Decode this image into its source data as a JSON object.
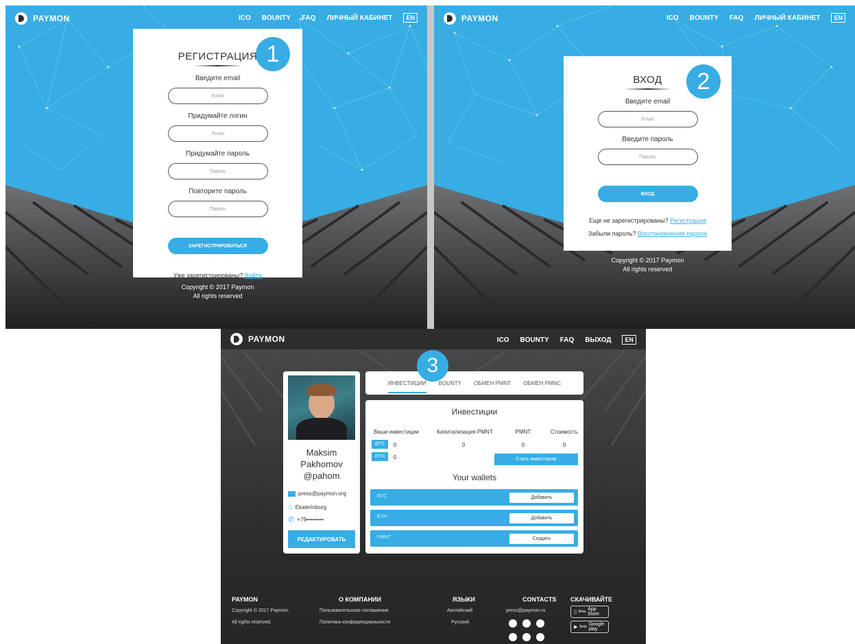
{
  "brand": "PAYMON",
  "colors": {
    "accent": "#37ade4",
    "dark": "#2d2d2d",
    "white": "#ffffff"
  },
  "register": {
    "nav": [
      "ICO",
      "BOUNTY",
      "FAQ",
      "ЛИЧНЫЙ КАБИНЕТ"
    ],
    "lang": "EN",
    "title": "РЕГИСТРАЦИЯ",
    "step": "1",
    "fields": [
      {
        "label": "Введите email",
        "placeholder": "Email"
      },
      {
        "label": "Придумайте логин",
        "placeholder": "Логин"
      },
      {
        "label": "Придумайте пароль",
        "placeholder": "Пароль"
      },
      {
        "label": "Повторите пароль",
        "placeholder": "Пароль"
      }
    ],
    "submit": "ЗАРЕГИСТРИРОВАТЬСЯ",
    "already": "Уже зарегистрированы?",
    "login_link": "Войти",
    "copyright": "Copyright © 2017 Paymon",
    "rights": "All rights reserved"
  },
  "login": {
    "nav": [
      "ICO",
      "BOUNTY",
      "FAQ",
      "ЛИЧНЫЙ КАБИНЕТ"
    ],
    "lang": "EN",
    "title": "ВХОД",
    "step": "2",
    "fields": [
      {
        "label": "Введите email",
        "placeholder": "Email"
      },
      {
        "label": "Введите пароль",
        "placeholder": "Пароль"
      }
    ],
    "submit": "ВХОД",
    "not_registered": "Еще не зарегистрированы?",
    "register_link": "Регистрация",
    "forgot": "Забыли пароль?",
    "restore_link": "Восстановление пароля",
    "copyright": "Copyright © 2017 Paymon",
    "rights": "All rights reserved"
  },
  "cabinet": {
    "nav": [
      "ICO",
      "BOUNTY",
      "FAQ",
      "ВЫХОД"
    ],
    "lang": "EN",
    "step": "3",
    "profile": {
      "first": "Maksim",
      "last": "Pakhomov",
      "handle": "@pahom",
      "email": "press@paymon.org",
      "city": "Ekaterinburg",
      "phone": "+79•••••••••",
      "edit": "РЕДАКТИРОВАТЬ"
    },
    "tabs": [
      "ИНВЕСТИЦИИ",
      "BOUNTY",
      "ОБМЕН PMNT",
      "ОБМЕН PMNC"
    ],
    "investments": {
      "title": "Инвестиции",
      "headers": [
        "Ваши инвестиции",
        "Капитализация PMNT",
        "PMNT",
        "Стоимость"
      ],
      "btc_tag": "BTC",
      "btc_val": "0",
      "eth_tag": "ETH",
      "eth_val": "0",
      "cap": "0",
      "pmnt": "0",
      "cost": "0",
      "invest_btn": "Стать инвестором"
    },
    "wallets": {
      "title": "Your wallets",
      "rows": [
        {
          "name": "BTC",
          "action": "Добавить"
        },
        {
          "name": "ETH",
          "action": "Добавить"
        },
        {
          "name": "PMNT",
          "action": "Создать"
        }
      ]
    },
    "footer": {
      "brand": "PAYMON",
      "copyright": "Copyright © 2017 Paymon.",
      "rights": "All rights reserved.",
      "about_h": "О КОМПАНИИ",
      "about": [
        "Пользовательское соглашение",
        "Политика конфиденциальности"
      ],
      "lang_h": "ЯЗЫКИ",
      "langs": [
        "Английский",
        "Русский"
      ],
      "contacts_h": "CONTACTS",
      "contact_email": "press@paymon.ru",
      "download_h": "СКАЧИВАЙТЕ",
      "appstore_small": "Beta",
      "appstore": "App Store",
      "gplay_small": "Beta",
      "gplay": "Google play"
    }
  }
}
